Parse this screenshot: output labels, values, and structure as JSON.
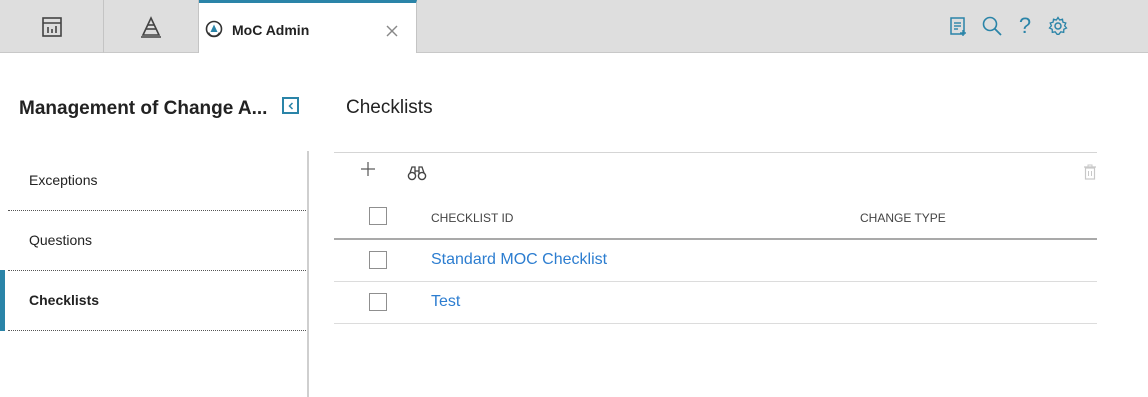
{
  "topbar": {
    "tabs": [
      {
        "icon": "dashboard-icon"
      },
      {
        "icon": "pyramid-icon"
      },
      {
        "icon": "moc-admin-icon",
        "title": "MoC Admin",
        "active": true
      }
    ],
    "actions": [
      "clipboard-icon",
      "search-icon",
      "help-icon",
      "settings-icon"
    ],
    "help_glyph": "?"
  },
  "sidebar": {
    "title": "Management of Change A...",
    "items": [
      {
        "label": "Exceptions",
        "active": false
      },
      {
        "label": "Questions",
        "active": false
      },
      {
        "label": "Checklists",
        "active": true
      }
    ]
  },
  "main": {
    "title": "Checklists",
    "columns": [
      "CHECKLIST ID",
      "CHANGE TYPE"
    ],
    "rows": [
      {
        "checklist_id": "Standard MOC Checklist",
        "change_type": ""
      },
      {
        "checklist_id": "Test",
        "change_type": ""
      }
    ]
  },
  "colors": {
    "accent": "#2a84a8",
    "link": "#2c7dd0",
    "topbar_bg": "#dedede"
  }
}
